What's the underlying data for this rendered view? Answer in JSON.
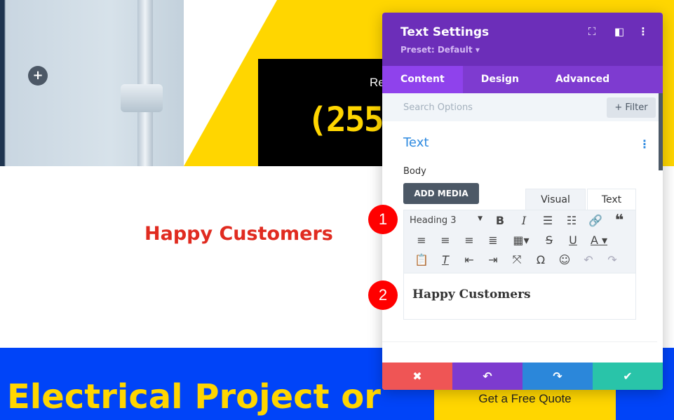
{
  "page": {
    "add_icon": "plus-icon",
    "call_text_partial": "Re",
    "phone_partial": "(255",
    "heading": "Happy Customers",
    "banner_text": "Electrical Project or",
    "cta_label": "Get a Free Quote",
    "colors": {
      "yellow": "#ffd600",
      "blue": "#0044f8",
      "heading_red": "#e02b20"
    }
  },
  "panel": {
    "title": "Text Settings",
    "preset": "Preset: Default ▾",
    "header_icons": [
      "expand-icon",
      "sidebar-layout-icon",
      "more-vertical-icon"
    ],
    "tabs": [
      {
        "label": "Content",
        "active": true
      },
      {
        "label": "Design"
      },
      {
        "label": "Advanced"
      }
    ],
    "search_placeholder": "Search Options",
    "filter_label": "+ Filter",
    "section_title": "Text",
    "body_label": "Body",
    "add_media_label": "ADD MEDIA",
    "editor_tabs": {
      "visual": "Visual",
      "text": "Text",
      "active": "Visual"
    },
    "format_select": "Heading 3",
    "editor_content": "Happy Customers",
    "footer": {
      "discard": "✖",
      "undo": "↶",
      "redo": "↷",
      "save": "✔"
    },
    "colors": {
      "header": "#6c2eb9",
      "tabs": "#7e3bd0",
      "active_tab": "#8f42ec",
      "discard": "#ef5555",
      "undo": "#7d3bcf",
      "redo": "#2b87da",
      "save": "#29c4a9"
    }
  },
  "annotations": [
    "1",
    "2"
  ]
}
